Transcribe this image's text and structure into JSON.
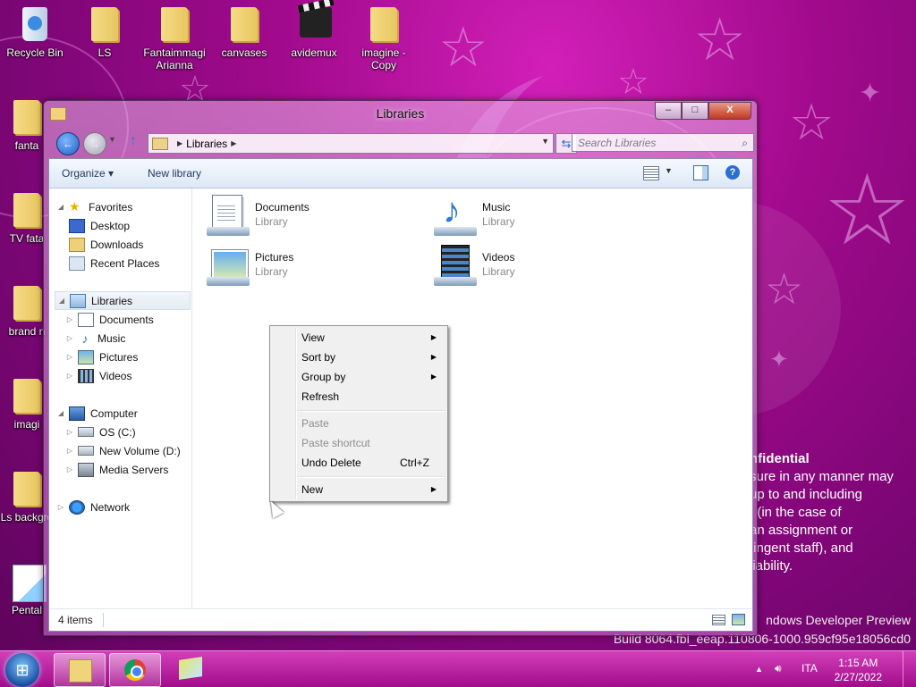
{
  "desktop": {
    "icons": [
      {
        "label": "Recycle Bin",
        "icon": "recycle-bin-icon"
      },
      {
        "label": "LS",
        "icon": "folder-icon"
      },
      {
        "label": "Fantaimmagi Arianna",
        "icon": "folder-icon"
      },
      {
        "label": "canvases",
        "icon": "folder-icon"
      },
      {
        "label": "avidemux",
        "icon": "clapperboard-icon"
      },
      {
        "label": "imagine - Copy",
        "icon": "folder-icon"
      },
      {
        "label": "fanta",
        "icon": "folder-icon"
      },
      {
        "label": "TV fata",
        "icon": "folder-icon"
      },
      {
        "label": "brand n",
        "icon": "folder-icon"
      },
      {
        "label": "imagi",
        "icon": "folder-icon"
      },
      {
        "label": "Ls backgro",
        "icon": "folder-icon"
      },
      {
        "label": "Pental",
        "icon": "pentalogix-icon"
      }
    ],
    "watermark": {
      "title": "nfidential",
      "lines": [
        "sure in any manner may",
        "up to and including",
        "t (in the case of",
        "an assignment or",
        "tingent staff), and",
        "liability."
      ],
      "preview": "ndows Developer Preview",
      "build": "Build 8064.fbl_eeap.110806-1000.959cf95e18056cd0"
    }
  },
  "window": {
    "title": "Libraries",
    "controls": {
      "minimize": "–",
      "maximize": "□",
      "close": "X"
    },
    "address": {
      "crumb": "Libraries"
    },
    "search": {
      "placeholder": "Search Libraries"
    },
    "toolbar": {
      "organize": "Organize",
      "new_library": "New library"
    },
    "nav": {
      "favorites": {
        "label": "Favorites",
        "items": [
          "Desktop",
          "Downloads",
          "Recent Places"
        ]
      },
      "libraries": {
        "label": "Libraries",
        "items": [
          "Documents",
          "Music",
          "Pictures",
          "Videos"
        ]
      },
      "computer": {
        "label": "Computer",
        "items": [
          "OS (C:)",
          "New Volume (D:)",
          "Media Servers"
        ]
      },
      "network": {
        "label": "Network"
      }
    },
    "libraries": [
      {
        "name": "Documents",
        "type": "Library",
        "icon": "documents-library-icon"
      },
      {
        "name": "Music",
        "type": "Library",
        "icon": "music-library-icon"
      },
      {
        "name": "Pictures",
        "type": "Library",
        "icon": "pictures-library-icon"
      },
      {
        "name": "Videos",
        "type": "Library",
        "icon": "videos-library-icon"
      }
    ],
    "status": {
      "count": "4 items"
    }
  },
  "context_menu": {
    "items": [
      {
        "label": "View",
        "submenu": true
      },
      {
        "label": "Sort by",
        "submenu": true
      },
      {
        "label": "Group by",
        "submenu": true
      },
      {
        "label": "Refresh"
      },
      {
        "label": "Paste",
        "disabled": true
      },
      {
        "label": "Paste shortcut",
        "disabled": true
      },
      {
        "label": "Undo Delete",
        "shortcut": "Ctrl+Z"
      },
      {
        "label": "New",
        "submenu": true
      }
    ]
  },
  "taskbar": {
    "language": "ITA",
    "time": "1:15 AM",
    "date": "2/27/2022",
    "tray_arrow": "▲",
    "volume_icon": "speaker-icon"
  },
  "colors": {
    "wallpaper_primary": "#a10a8c",
    "wallpaper_accent": "#d21fb8",
    "selection": "#e4ebf3"
  }
}
